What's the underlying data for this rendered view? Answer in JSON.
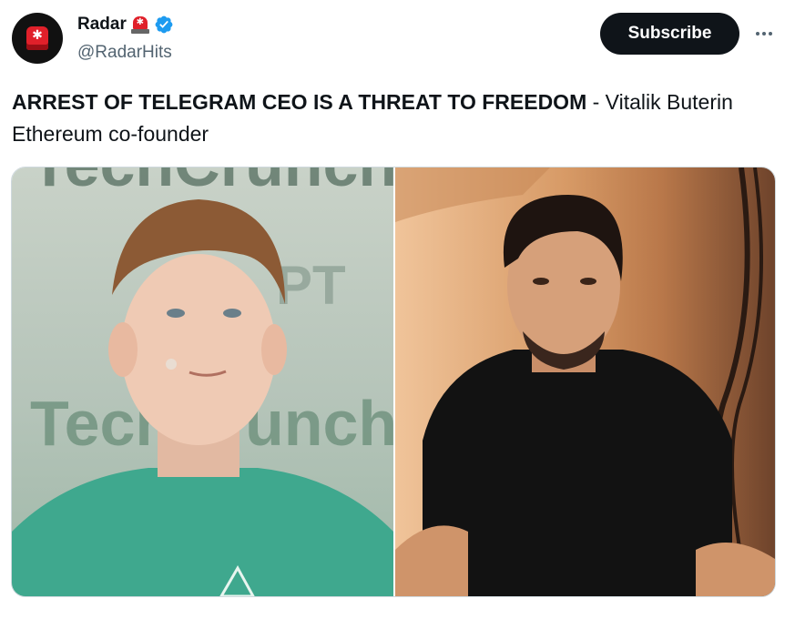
{
  "author": {
    "name": "Radar",
    "handle": "@RadarHits",
    "avatar_icon": "siren-icon",
    "name_emoji": "siren-emoji",
    "verified_icon": "verified-badge-icon",
    "verified_color": "#1d9bf0"
  },
  "actions": {
    "subscribe_label": "Subscribe",
    "more_icon": "more-horizontal-icon"
  },
  "tweet": {
    "headline": "ARREST OF TELEGRAM CEO IS A THREAT TO FREEDOM",
    "rest": " - Vitalik Buterin Ethereum co-founder"
  },
  "media": {
    "left_backdrop_text_top": "TechCrunch",
    "left_backdrop_text_mid": "PT",
    "left_backdrop_text_bottom": "TechCrunch"
  }
}
